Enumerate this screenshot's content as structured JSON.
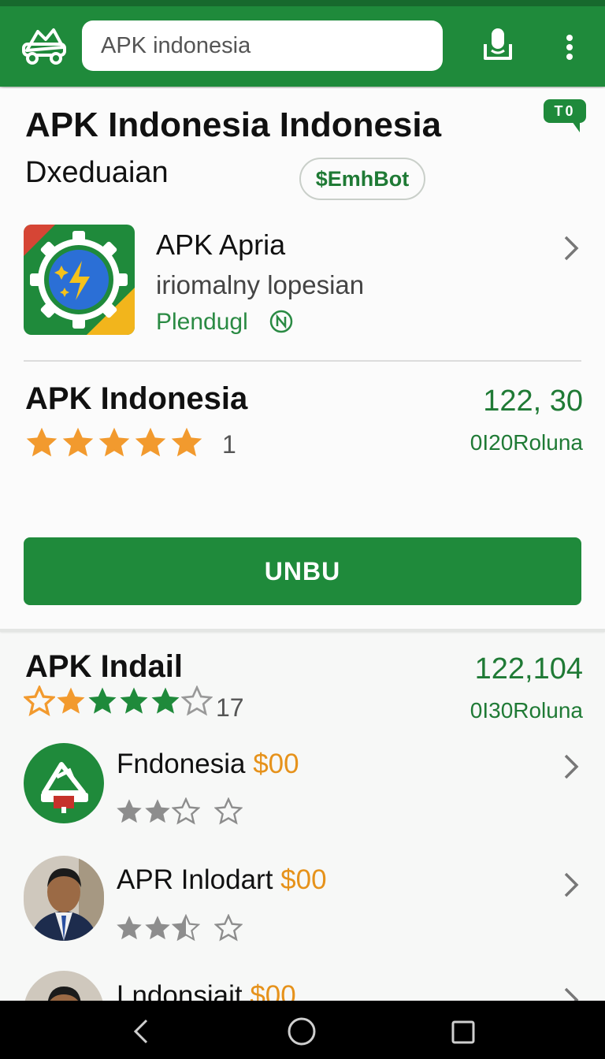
{
  "search": {
    "value": "APK indonesia"
  },
  "header": {
    "badge": "T0",
    "title": "APK Indonesia Indonesia",
    "subtitle": "Dxeduaian",
    "pill": "$EmhBot"
  },
  "featured_app": {
    "name": "APK Apria",
    "description": "iriomalny lopesian",
    "developer": "Plendugl"
  },
  "section1": {
    "title": "APK Indonesia",
    "rating_count": "1",
    "price": "122, 30",
    "price_sub": "0I20Roluna",
    "rating_value": 5
  },
  "install_button": "UNBU",
  "section2": {
    "title": "APK Indail",
    "rating_count": "17",
    "price": "122,104",
    "price_sub": "0I30Roluna"
  },
  "list_items": [
    {
      "name": "Fndonesia",
      "price": "$00",
      "rating": 2
    },
    {
      "name": "APR Inlodart",
      "price": "$00",
      "rating": 2.5
    },
    {
      "name": "Lndonsiait",
      "price": "$00"
    }
  ],
  "colors": {
    "primary_green": "#1f8a3b",
    "star_orange": "#f29a2e",
    "price_orange": "#e6921b"
  },
  "icons": [
    "app-logo-icon",
    "mic-icon",
    "more-vert-icon",
    "back-icon",
    "home-icon",
    "recents-icon",
    "chevron-right-icon",
    "verified-badge-icon",
    "star-icon"
  ]
}
